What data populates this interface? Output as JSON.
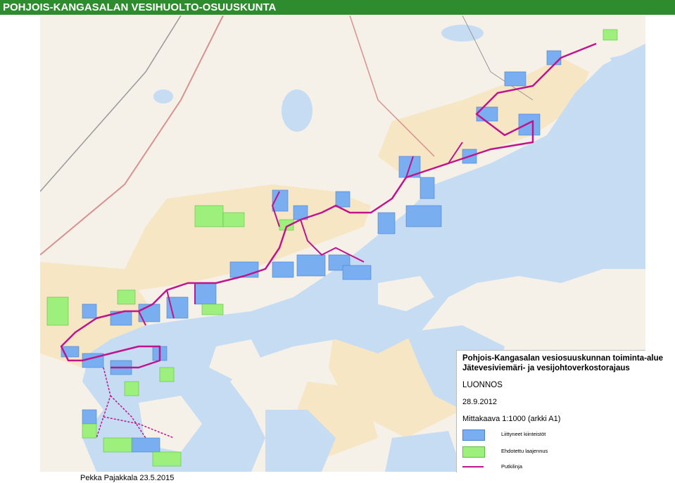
{
  "header": {
    "title": "POHJOIS-KANGASALAN VESIHUOLTO-OSUUSKUNTA"
  },
  "legend": {
    "title_line1": "Pohjois-Kangasalan vesiosuuskunnan toiminta-alue",
    "title_line2": "Jätevesiviemäri- ja vesijohtoverkostorajaus",
    "status": "LUONNOS",
    "date": "28.9.2012",
    "scale": "Mittakaava 1:1000 (arkki A1)",
    "items": [
      {
        "label": "Liittyneet kiinteistöt",
        "color": "#79aef0"
      },
      {
        "label": "Ehdotettu laajennus",
        "color": "#9ef07c"
      },
      {
        "label": "Putkilinja",
        "color": "#c0148c"
      }
    ]
  },
  "footer": {
    "author": "Pekka Pajakkala 23.5.2015"
  },
  "map": {
    "colors": {
      "water": "#c6dcf2",
      "land": "#f7f3ea",
      "fields": "#f6e6c4",
      "connected": "#79aef0",
      "proposed": "#9ef07c",
      "pipeline": "#c0148c",
      "road": "#e0a0a0"
    }
  }
}
